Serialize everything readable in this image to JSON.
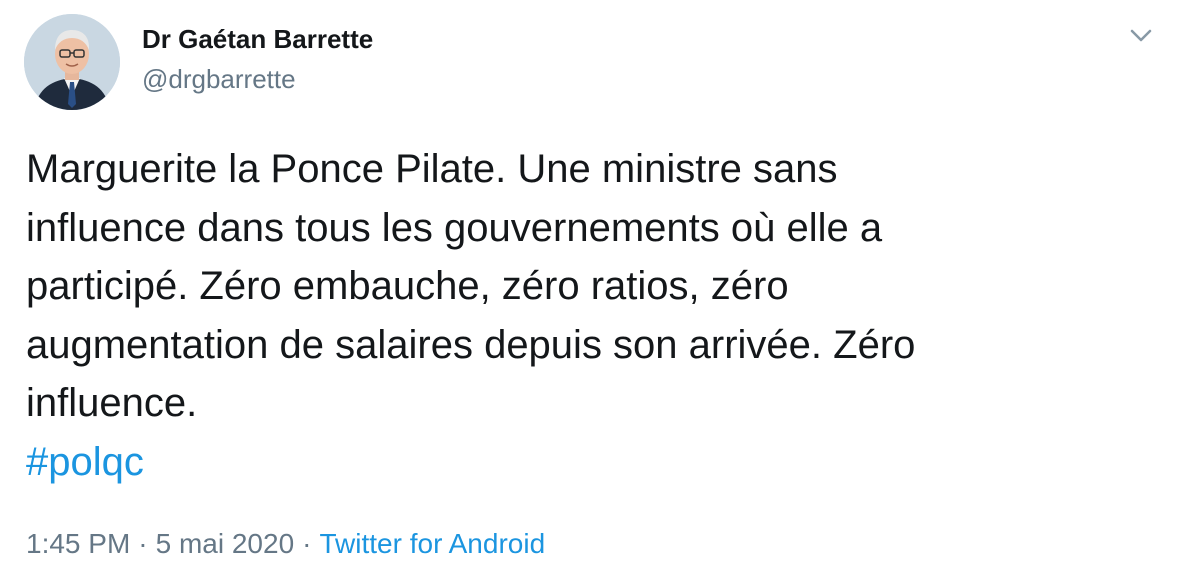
{
  "author": {
    "display_name": "Dr Gaétan Barrette",
    "handle": "@drgbarrette"
  },
  "tweet": {
    "lines": [
      "Marguerite la Ponce Pilate. Une ministre sans",
      "influence dans tous les gouvernements où elle a",
      "participé. Zéro embauche, zéro ratios, zéro",
      "augmentation de salaires depuis son arrivée. Zéro",
      "influence."
    ],
    "hashtag": "#polqc"
  },
  "meta": {
    "time": "1:45 PM",
    "date": "5 mai 2020",
    "separator": "·",
    "source": "Twitter for Android"
  },
  "icons": {
    "menu": "chevron-down-icon",
    "avatar": "profile-photo"
  },
  "colors": {
    "text": "#14171a",
    "secondary": "#657786",
    "link": "#1b95e0"
  }
}
